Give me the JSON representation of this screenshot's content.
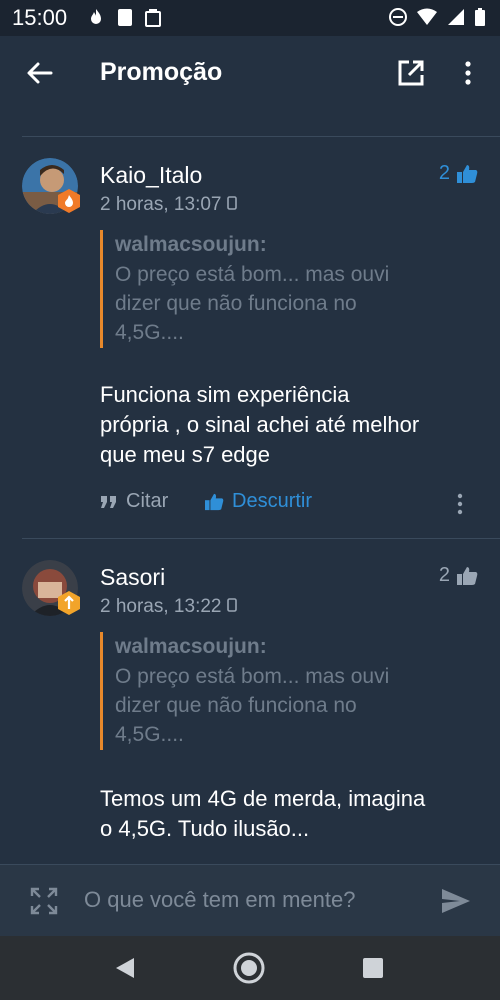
{
  "status_bar": {
    "time": "15:00"
  },
  "app_bar": {
    "title": "Promoção"
  },
  "comments": [
    {
      "username": "Kaio_Italo",
      "timestamp": "2 horas, 13:07",
      "likes": "2",
      "quote_author": "walmacsoujun:",
      "quote_lines": [
        "O preço está bom... mas ouvi",
        "dizer que não funciona no",
        "4,5G...."
      ],
      "body_lines": [
        "Funciona sim experiência",
        "própria , o sinal achei até melhor",
        "que meu s7 edge"
      ],
      "actions": {
        "quote_label": "Citar",
        "unlike_label": "Descurtir"
      }
    },
    {
      "username": "Sasori",
      "timestamp": "2 horas, 13:22",
      "likes": "2",
      "quote_author": "walmacsoujun:",
      "quote_lines": [
        "O preço está bom... mas ouvi",
        "dizer que não funciona no",
        "4,5G...."
      ],
      "body_lines": [
        "Temos um 4G de merda, imagina",
        "o 4,5G. Tudo ilusão..."
      ]
    }
  ],
  "composer": {
    "placeholder": "O que você tem em mente?"
  },
  "colors": {
    "accent": "#2f8fd8",
    "quote_bar": "#e8892b",
    "background": "#243141"
  },
  "icons": [
    "back-arrow-icon",
    "open-external-icon",
    "more-vert-icon",
    "thumbs-up-icon",
    "quote-icon",
    "expand-icon",
    "send-icon",
    "nav-back-icon",
    "nav-home-icon",
    "nav-recents-icon"
  ]
}
